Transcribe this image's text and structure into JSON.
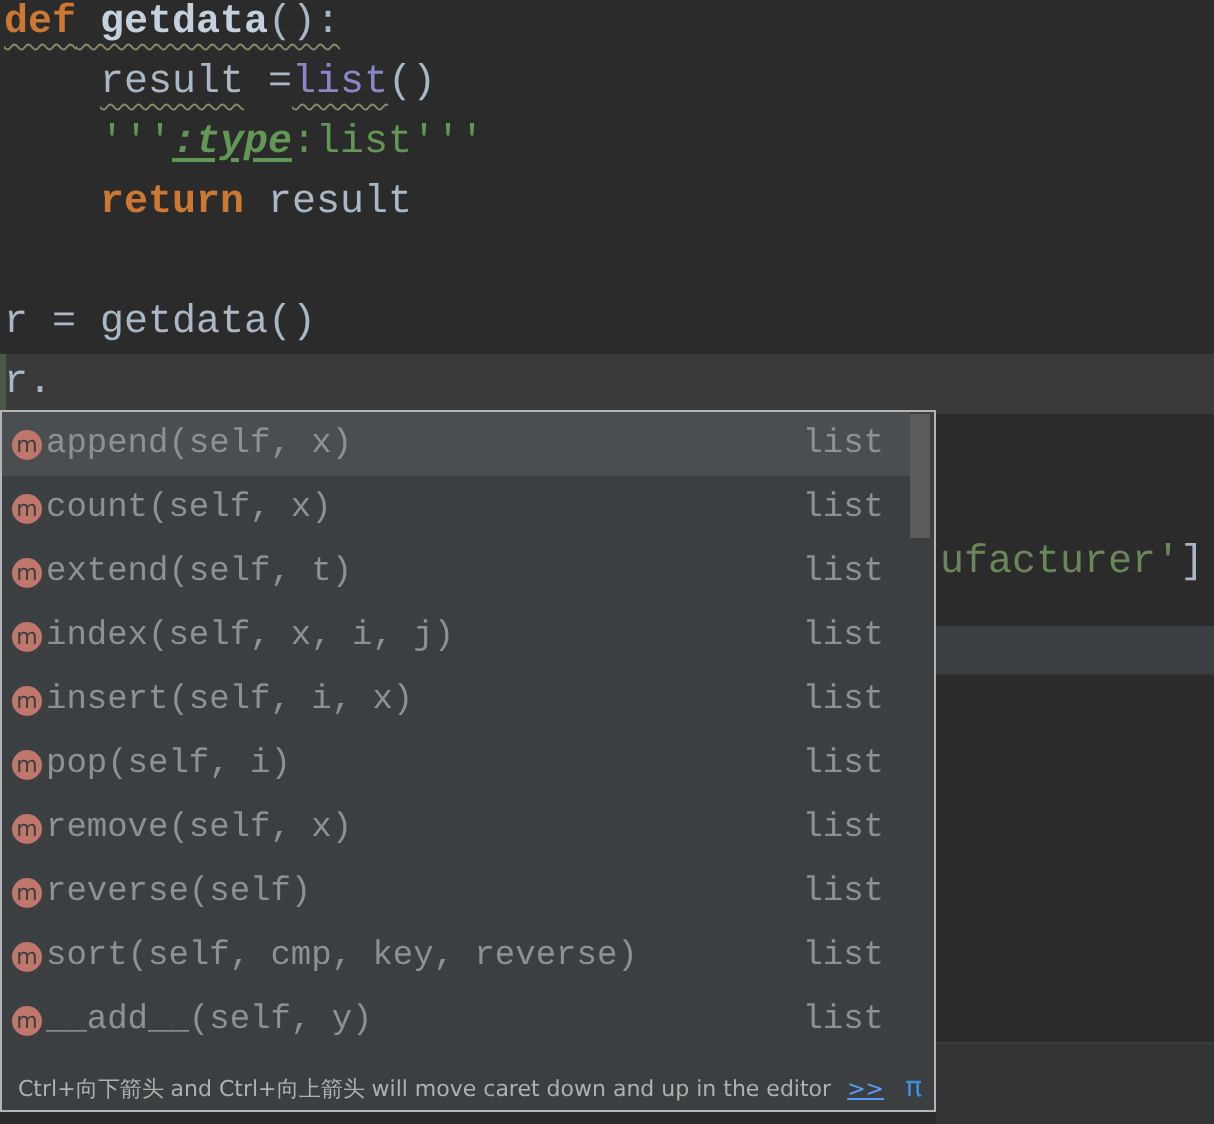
{
  "editor": {
    "lines": [
      {
        "kind": "code",
        "current": false,
        "indented": false,
        "tokens": [
          {
            "text": "def",
            "kind": "keyword",
            "underlined": true
          },
          {
            "text": " getdata",
            "kind": "funcdef",
            "underlined": true
          },
          {
            "text": "():",
            "kind": "plain",
            "underlined": true
          }
        ]
      },
      {
        "kind": "code",
        "current": false,
        "indented": true,
        "tokens": [
          {
            "text": "result",
            "kind": "plain",
            "underlined": true
          },
          {
            "text": " =",
            "kind": "plain",
            "underlined": false
          },
          {
            "text": "list",
            "kind": "builtin",
            "underlined": true
          },
          {
            "text": "()",
            "kind": "plain",
            "underlined": false
          }
        ]
      },
      {
        "kind": "code",
        "current": false,
        "indented": true,
        "tokens": [
          {
            "text": "'''",
            "kind": "doc",
            "underlined": false
          },
          {
            "text": ":type",
            "kind": "doctag",
            "underlined": false
          },
          {
            "text": ":list'''",
            "kind": "doc",
            "underlined": false
          }
        ]
      },
      {
        "kind": "code",
        "current": false,
        "indented": true,
        "tokens": [
          {
            "text": "return",
            "kind": "keyword",
            "underlined": false
          },
          {
            "text": " result",
            "kind": "plain",
            "underlined": false
          }
        ]
      },
      {
        "kind": "blank"
      },
      {
        "kind": "code",
        "current": false,
        "indented": false,
        "tokens": [
          {
            "text": "r = getdata()",
            "kind": "plain",
            "underlined": false
          }
        ]
      },
      {
        "kind": "code",
        "current": true,
        "indented": false,
        "tokens": [
          {
            "text": "r.",
            "kind": "plain",
            "underlined": false
          }
        ]
      },
      {
        "kind": "partial",
        "tokens": [
          {
            "text": "ufacturer'",
            "kind": "string",
            "underlined": false
          },
          {
            "text": "]",
            "kind": "plain",
            "underlined": false
          }
        ]
      }
    ]
  },
  "completion": {
    "items": [
      {
        "icon_letter": "m",
        "name": "append(self, x)",
        "type": "list",
        "selected": true
      },
      {
        "icon_letter": "m",
        "name": "count(self, x)",
        "type": "list",
        "selected": false
      },
      {
        "icon_letter": "m",
        "name": "extend(self, t)",
        "type": "list",
        "selected": false
      },
      {
        "icon_letter": "m",
        "name": "index(self, x, i, j)",
        "type": "list",
        "selected": false
      },
      {
        "icon_letter": "m",
        "name": "insert(self, i, x)",
        "type": "list",
        "selected": false
      },
      {
        "icon_letter": "m",
        "name": "pop(self, i)",
        "type": "list",
        "selected": false
      },
      {
        "icon_letter": "m",
        "name": "remove(self, x)",
        "type": "list",
        "selected": false
      },
      {
        "icon_letter": "m",
        "name": "reverse(self)",
        "type": "list",
        "selected": false
      },
      {
        "icon_letter": "m",
        "name": "sort(self, cmp, key, reverse)",
        "type": "list",
        "selected": false
      },
      {
        "icon_letter": "m",
        "name": "__add__(self, y)",
        "type": "list",
        "selected": false
      }
    ],
    "footer": {
      "hint": "Ctrl+向下箭头 and Ctrl+向上箭头 will move caret down and up in the editor",
      "link": ">>",
      "pin": "π"
    }
  }
}
